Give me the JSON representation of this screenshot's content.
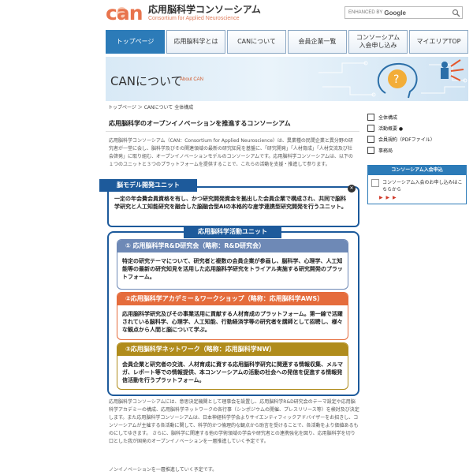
{
  "header": {
    "logo_mark": "can",
    "logo_title": "応用脳科学コンソーシアム",
    "logo_subtitle": "Consortium for Applied Neuroscience",
    "search_placeholder": "ENHANCED BY",
    "search_brand": "Google"
  },
  "nav": {
    "items": [
      {
        "label": "トップページ"
      },
      {
        "label": "応用脳科学とは"
      },
      {
        "label": "CANについて"
      },
      {
        "label": "会員企業一覧"
      },
      {
        "label": "コンソーシアム\n入会申し込み"
      },
      {
        "label": "マイエリアTOP"
      }
    ]
  },
  "hero": {
    "title": "CANについて",
    "subtitle": "About CAN"
  },
  "breadcrumb": "トップページ ＞ CANについて 全体構成",
  "main": {
    "heading": "応用脳科学のオープンイノベーションを推進するコンソーシアム",
    "intro": "応用脳科学コンソーシアム（CAN：Consortium for Applied Neuroscience）は、異業種の民間企業と異分野の研究者が一堂に会し、脳科学及びその関連領域の最新の研究知見を基盤に、「研究開発」「人材育成」「人材交流及び社会啓発」に取り組む、オープンイノベーションモデルのコンソーシアムです。応用脳科学コンソーシアムは、以下の１つのユニットと３つのプラットフォームを提供することで、これらの活動を支援・推進して参ります。",
    "unit_badge": "有料",
    "unit_title": "脳モデル開発ユニット",
    "unit_text": "一定の年会費会員資格を有し、かつ研究開発資金を拠出した会員企業で構成され、共同で脳科学研究と人工知能研究を融合した脳融合型AIの本格的な産学連携型研究開発を行うユニット。",
    "activity_title": "応用脳科学活動ユニット",
    "platforms": [
      {
        "title": "① 応用脳科学R&D研究会（略称：R&D研究会）",
        "text": "特定の研究テーマについて、研究者と複数の会員企業が参画し、脳科学、心理学、人工知能等の最新の研究知見を活用した応用脳科学研究をトライアル実施する研究開発のプラットフォーム。"
      },
      {
        "title": "②応用脳科学アカデミー＆ワークショップ（略称：応用脳科学AWS）",
        "text": "応用脳科学研究及びその事業活用に貢献する人材育成のプラットフォーム。第一線で活躍されている脳科学、心理学、人工知能、行動経済学等の研究者を講師として招聘し、様々な観点から人間と脳について学ぶ。"
      },
      {
        "title": "③応用脳科学ネットワーク（略称：応用脳科学NW）",
        "text": "会員企業と研究者の交流、人材育成に資する応用脳科学研究に関連する情報収集、メルマガ、レポート等での情報提供、本コンソーシアムの活動の社会への発信を促進する情報発信活動を行うプラットフォーム。"
      }
    ],
    "outro": "応用脳科学コンソーシアムには、意思決定機関として理事会を設置し、応用脳科学R&D研究会のテーマ設定や応用脳科学アカデミーの構成、応用脳科学ネットワークの各行事（シンポジウムの開催、プレスリリース等）を検討及び決定します。また応用脳科学コンソーシアムは、日本神経科学学会よりサイエンティフィックアドバイザーをお招きし、コンソーシアムが主催する各活動に関して、科学的かつ倫理的な観点から助言を受けることで、各活動をより価値あるものにしてゆきます。 さらに、脳科学に関連する他の学術領域の学会や研究者との連携強化を図り、応用脳科学を切り口とした我が国発のオープンイノベーションを一層推進していく予定です。",
    "outro_last": "ノンイノベーションを一層推進していく予定です。"
  },
  "sidebar": {
    "links": [
      {
        "label": "全体構成",
        "icon": "doc-icon"
      },
      {
        "label": "活動概要 ●",
        "icon": "doc-icon"
      },
      {
        "label": "会員規約（PDFファイル）",
        "icon": "pdf-icon"
      },
      {
        "label": "事務局",
        "icon": "doc-icon"
      }
    ],
    "join_header": "コンソーシアム入会申込",
    "join_text": "コンソーシアム入会のお申し込みはこちらから",
    "join_arrows": "▶ ▶ ▶"
  },
  "colors": {
    "nav_active": "#2c7bb8",
    "unit_navy": "#1d5a9b",
    "platform1": "#6e89b6",
    "platform2": "#e56c3c",
    "platform3": "#b08c1c",
    "hero_accent": "#d25a2a"
  }
}
